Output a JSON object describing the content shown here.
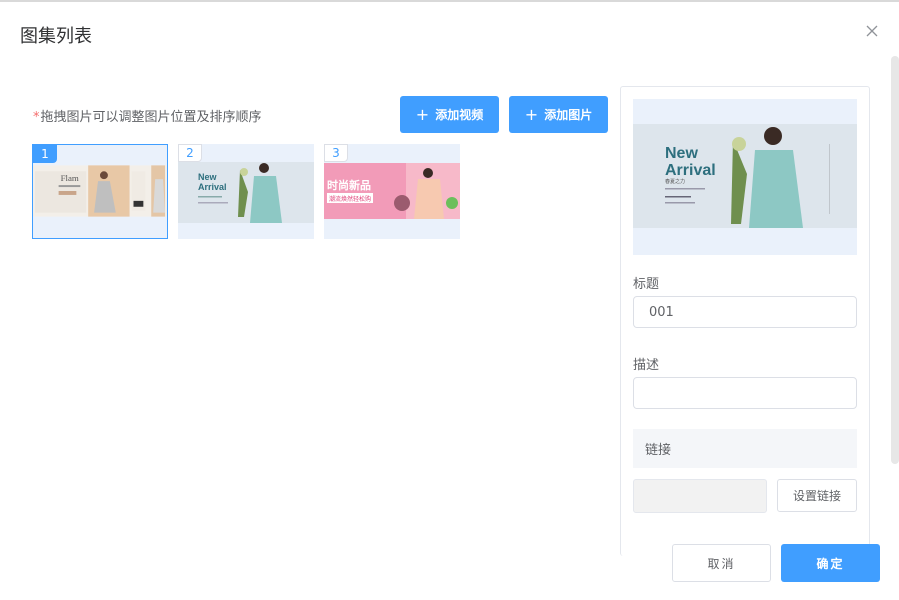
{
  "dialog": {
    "title": "图集列表"
  },
  "hint": {
    "required_mark": "*",
    "text": "拖拽图片可以调整图片位置及排序顺序"
  },
  "toolbar": {
    "add_video": "添加视频",
    "add_image": "添加图片"
  },
  "thumbnails": [
    {
      "index": "1",
      "caption_top": "Flam",
      "selected": true
    },
    {
      "index": "2",
      "line1": "New",
      "line2": "Arrival",
      "selected": false
    },
    {
      "index": "3",
      "headline": "时尚新品",
      "tagline": "潮流焕然轻松购",
      "selected": false
    }
  ],
  "preview": {
    "line1": "New",
    "line2": "Arrival",
    "sub": "春夏之力"
  },
  "form": {
    "title_label": "标题",
    "title_value": "001",
    "desc_label": "描述",
    "desc_value": "",
    "link_label": "链接",
    "link_value": "",
    "set_link": "设置链接"
  },
  "footer": {
    "cancel": "取消",
    "confirm": "确定"
  },
  "colors": {
    "primary": "#409eff",
    "required": "#f56c6c",
    "thumb_bg": "#eaf1fb"
  }
}
